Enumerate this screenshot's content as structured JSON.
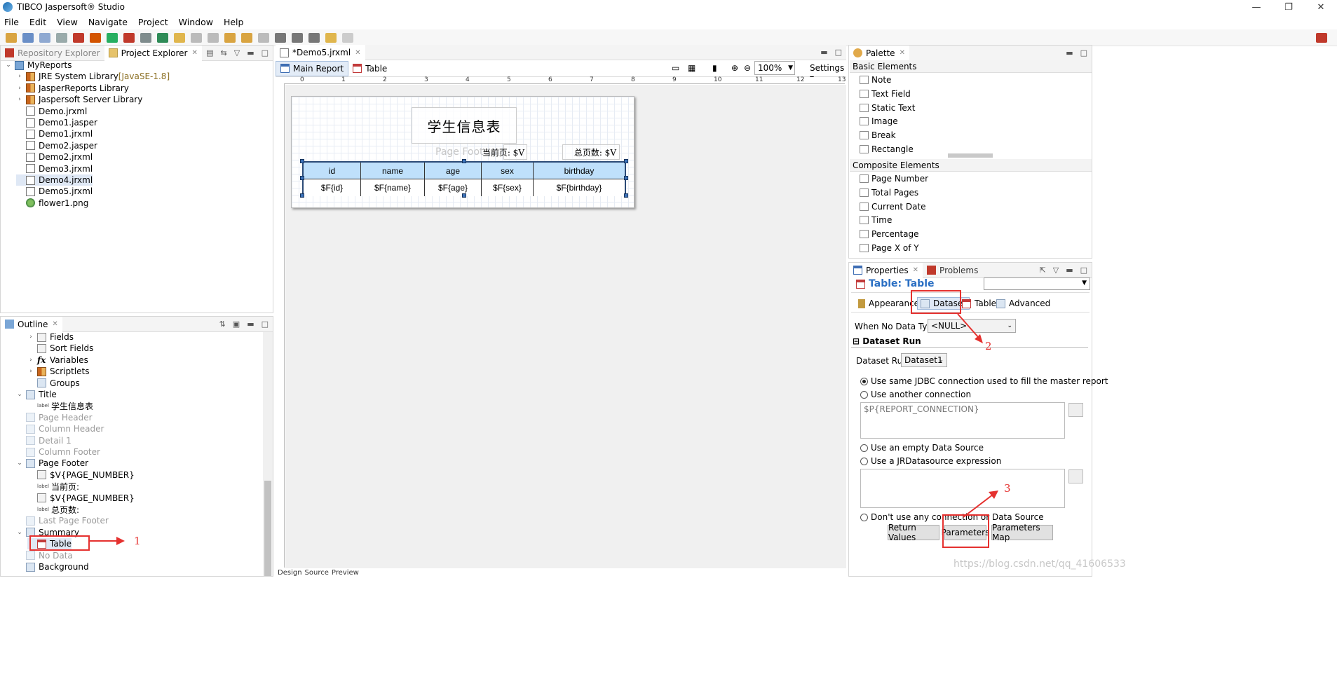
{
  "window": {
    "title": "TIBCO Jaspersoft® Studio",
    "controls": [
      "—",
      "❐",
      "✕"
    ]
  },
  "menu": [
    "File",
    "Edit",
    "View",
    "Navigate",
    "Project",
    "Window",
    "Help"
  ],
  "left_top": {
    "tabs": [
      {
        "label": "Repository Explorer"
      },
      {
        "label": "Project Explorer"
      }
    ],
    "tree": [
      {
        "label": "MyReports",
        "level": 0,
        "icon": "project-icon",
        "twisty": "⌄"
      },
      {
        "label": "JRE System Library",
        "suffix": "[JavaSE-1.8]",
        "level": 1,
        "icon": "library-icon",
        "twisty": "›"
      },
      {
        "label": "JasperReports Library",
        "level": 1,
        "icon": "library-icon",
        "twisty": "›"
      },
      {
        "label": "Jaspersoft Server Library",
        "level": 1,
        "icon": "library-icon",
        "twisty": "›"
      },
      {
        "label": "Demo.jrxml",
        "level": 1,
        "icon": "jrxml-file-icon"
      },
      {
        "label": "Demo1.jasper",
        "level": 1,
        "icon": "jasper-file-icon"
      },
      {
        "label": "Demo1.jrxml",
        "level": 1,
        "icon": "jrxml-file-icon"
      },
      {
        "label": "Demo2.jasper",
        "level": 1,
        "icon": "jasper-file-icon"
      },
      {
        "label": "Demo2.jrxml",
        "level": 1,
        "icon": "jrxml-file-icon"
      },
      {
        "label": "Demo3.jrxml",
        "level": 1,
        "icon": "jrxml-file-icon"
      },
      {
        "label": "Demo4.jrxml",
        "level": 1,
        "icon": "jrxml-file-icon",
        "selected": true
      },
      {
        "label": "Demo5.jrxml",
        "level": 1,
        "icon": "jrxml-file-icon"
      },
      {
        "label": "flower1.png",
        "level": 1,
        "icon": "image-file-icon"
      }
    ]
  },
  "outline": {
    "tab": "Outline",
    "items": [
      {
        "label": "Fields",
        "level": 1,
        "twisty": "›",
        "icon": "fields-icon"
      },
      {
        "label": "Sort Fields",
        "level": 1,
        "icon": "sort-fields-icon"
      },
      {
        "label": "Variables",
        "level": 1,
        "twisty": "›",
        "icon": "fx-icon"
      },
      {
        "label": "Scriptlets",
        "level": 1,
        "twisty": "›",
        "icon": "scriptlets-icon"
      },
      {
        "label": "Groups",
        "level": 1,
        "icon": "groups-icon"
      },
      {
        "label": "Title",
        "level": 0,
        "twisty": "⌄",
        "icon": "band-icon"
      },
      {
        "label": "学生信息表",
        "level": 1,
        "icon": "label-icon"
      },
      {
        "label": "Page Header",
        "level": 0,
        "icon": "band-icon",
        "grey": true
      },
      {
        "label": "Column Header",
        "level": 0,
        "icon": "band-icon",
        "grey": true
      },
      {
        "label": "Detail 1",
        "level": 0,
        "icon": "band-icon",
        "grey": true
      },
      {
        "label": "Column Footer",
        "level": 0,
        "icon": "band-icon",
        "grey": true
      },
      {
        "label": "Page Footer",
        "level": 0,
        "twisty": "⌄",
        "icon": "band-icon"
      },
      {
        "label": "$V{PAGE_NUMBER}",
        "level": 1,
        "icon": "textfield-icon"
      },
      {
        "label": "当前页:",
        "level": 1,
        "icon": "label-icon"
      },
      {
        "label": "$V{PAGE_NUMBER}",
        "level": 1,
        "icon": "textfield-icon"
      },
      {
        "label": "总页数:",
        "level": 1,
        "icon": "label-icon"
      },
      {
        "label": "Last Page Footer",
        "level": 0,
        "icon": "band-icon",
        "grey": true
      },
      {
        "label": "Summary",
        "level": 0,
        "twisty": "⌄",
        "icon": "band-icon"
      },
      {
        "label": "Table",
        "level": 1,
        "icon": "table-icon",
        "selected": true
      },
      {
        "label": "No Data",
        "level": 0,
        "icon": "band-icon",
        "grey": true
      },
      {
        "label": "Background",
        "level": 0,
        "icon": "band-icon"
      }
    ]
  },
  "editor": {
    "tab": "*Demo5.jrxml",
    "subtabs": [
      "Main Report",
      "Table"
    ],
    "zoom": "100%",
    "settings": "Settings",
    "ruler_marks": [
      "0",
      "1",
      "2",
      "3",
      "4",
      "5",
      "6",
      "7",
      "8",
      "9",
      "10",
      "11",
      "12",
      "13"
    ],
    "report_title": "学生信息表",
    "page_footer_ghost": "Page Foote",
    "current_page_label": "当前页: $V",
    "total_pages_label": "总页数: $V",
    "table": {
      "headers": [
        "id",
        "name",
        "age",
        "sex",
        "birthday"
      ],
      "cells": [
        "$F{id}",
        "$F{name}",
        "$F{age}",
        "$F{sex}",
        "$F{birthday}"
      ]
    },
    "bottom_tabs": [
      "Design",
      "Source",
      "Preview"
    ]
  },
  "palette": {
    "tab": "Palette",
    "sections": [
      {
        "title": "Basic Elements",
        "items": [
          {
            "label": "Note",
            "icon": "note-icon"
          },
          {
            "label": "Text Field",
            "icon": "textfield-icon"
          },
          {
            "label": "Static Text",
            "icon": "label-icon"
          },
          {
            "label": "Image",
            "icon": "image-icon"
          },
          {
            "label": "Break",
            "icon": "break-icon"
          },
          {
            "label": "Rectangle",
            "icon": "rectangle-icon"
          }
        ]
      },
      {
        "title": "Composite Elements",
        "items": [
          {
            "label": "Page Number",
            "icon": "page-number-icon"
          },
          {
            "label": "Total Pages",
            "icon": "total-pages-icon"
          },
          {
            "label": "Current Date",
            "icon": "calendar-icon"
          },
          {
            "label": "Time",
            "icon": "calendar-icon"
          },
          {
            "label": "Percentage",
            "icon": "percentage-icon"
          },
          {
            "label": "Page X of Y",
            "icon": "page-x-of-y-icon"
          }
        ]
      }
    ]
  },
  "properties": {
    "tabs": [
      "Properties",
      "Problems"
    ],
    "title": "Table: Table",
    "subtabs": [
      "Appearance",
      "Dataset",
      "Table",
      "Advanced"
    ],
    "when_no_data_label": "When No Data Type",
    "when_no_data_value": "<NULL>",
    "section_title": "Dataset Run",
    "dataset_run_label": "Dataset Run",
    "dataset_run_value": "Dataset1",
    "radios": [
      "Use same JDBC connection used to fill the master report",
      "Use another connection",
      "Use an empty Data Source",
      "Use a JRDatasource expression",
      "Don't use any connection or Data Source"
    ],
    "connection_expr": "$P{REPORT_CONNECTION}",
    "buttons": [
      "Return Values",
      "Parameters",
      "Parameters Map"
    ]
  },
  "annotations": [
    "1",
    "2",
    "3"
  ],
  "watermark": "https://blog.csdn.net/qq_41606533",
  "colors": {
    "annotation": "#e5312f",
    "header_fill": "#bfe0fb",
    "selection": "#dfe8f5",
    "accent": "#2a6fc3"
  }
}
